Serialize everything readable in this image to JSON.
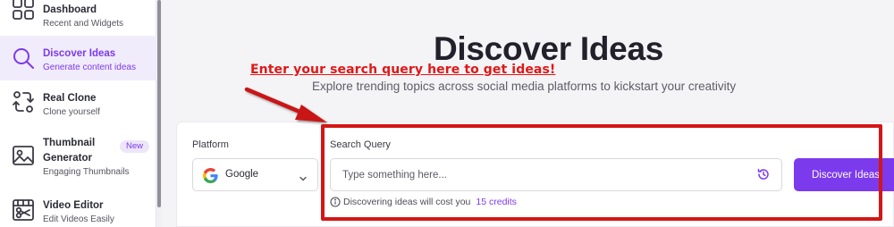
{
  "sidebar": {
    "items": [
      {
        "title": "Dashboard",
        "subtitle": "Recent and Widgets",
        "icon": "grid-icon"
      },
      {
        "title": "Discover Ideas",
        "subtitle": "Generate content ideas",
        "icon": "search-icon",
        "active": true
      },
      {
        "title": "Real Clone",
        "subtitle": "Clone yourself",
        "icon": "clone-swap-icon"
      },
      {
        "title": "Thumbnail",
        "title2": "Generator",
        "subtitle": "Engaging Thumbnails",
        "icon": "image-icon",
        "badge": "New"
      },
      {
        "title": "Video Editor",
        "subtitle": "Edit Videos Easily",
        "icon": "film-scissors-icon"
      }
    ]
  },
  "main": {
    "title": "Discover Ideas",
    "subtitle": "Explore trending topics across social media platforms to kickstart your creativity"
  },
  "annotation": {
    "text": "Enter your search query here to get ideas!",
    "color": "#e01818"
  },
  "form": {
    "platform_label": "Platform",
    "platform_value": "Google",
    "query_label": "Search Query",
    "query_value": "",
    "query_placeholder": "Type something here...",
    "button_label": "Discover Ideas",
    "cost_text": "Discovering ideas will cost you",
    "cost_credits": "15 credits"
  },
  "colors": {
    "accent": "#7c3aed",
    "annotation_red": "#d41616"
  }
}
